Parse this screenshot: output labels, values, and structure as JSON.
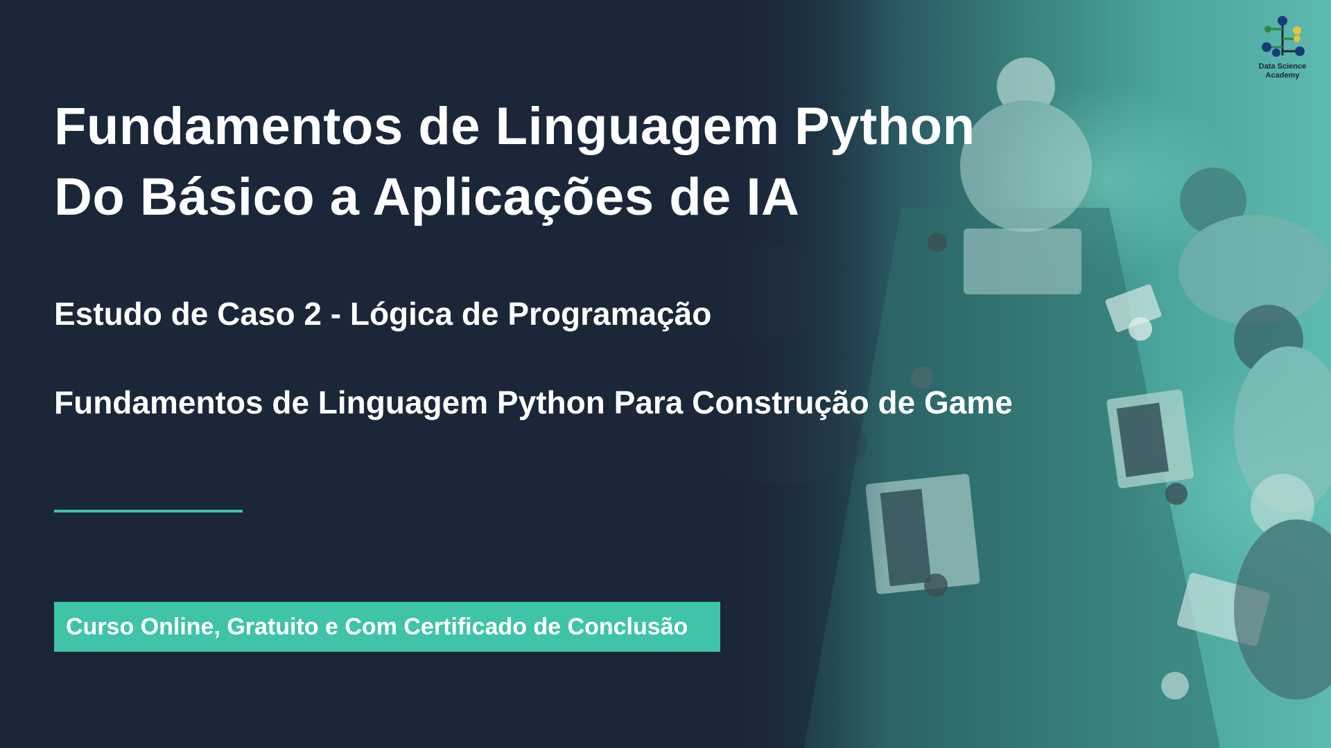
{
  "slide": {
    "title_line1": "Fundamentos de Linguagem Python",
    "title_line2": "Do Básico a Aplicações de IA",
    "subtitle1": "Estudo de Caso 2 - Lógica de Programação",
    "subtitle2": "Fundamentos de Linguagem Python Para Construção de Game",
    "badge_text": "Curso Online, Gratuito e Com Certificado de Conclusão"
  },
  "logo": {
    "text_line1": "Data Science",
    "text_line2": "Academy",
    "icon": "network-tree-logo-icon"
  },
  "colors": {
    "background": "#1b2638",
    "accent": "#40c4a8",
    "photo_tint": "#4aa59c",
    "text": "#ffffff"
  }
}
